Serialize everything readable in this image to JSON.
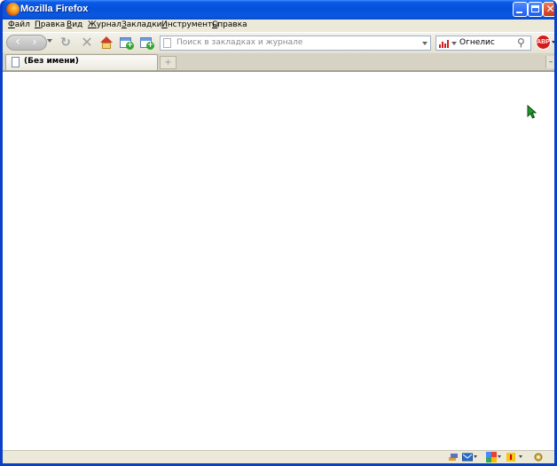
{
  "window": {
    "title": "Mozilla Firefox"
  },
  "menubar": {
    "items": [
      {
        "pre": "",
        "accel": "Ф",
        "post": "айл"
      },
      {
        "pre": "",
        "accel": "П",
        "post": "равка"
      },
      {
        "pre": "",
        "accel": "В",
        "post": "ид"
      },
      {
        "pre": "",
        "accel": "Ж",
        "post": "урнал"
      },
      {
        "pre": "",
        "accel": "З",
        "post": "акладки"
      },
      {
        "pre": "",
        "accel": "И",
        "post": "нструменты"
      },
      {
        "pre": "",
        "accel": "С",
        "post": "правка"
      }
    ]
  },
  "navbar": {
    "url_placeholder": "Поиск в закладках и журнале",
    "search_value": "Огнелис",
    "adblock_label": "ABP"
  },
  "tabs": [
    {
      "title": "(Без имени)"
    }
  ],
  "icons": {
    "back": "back-arrow-icon",
    "forward": "forward-arrow-icon",
    "reload": "reload-icon",
    "stop": "stop-icon",
    "home": "home-icon",
    "bookmark_add": "bookmark-add-icon",
    "new_tab": "new-tab-icon",
    "search_engine": "bar-chart-icon",
    "search_go": "magnifier-icon",
    "adblock": "adblock-icon",
    "cursor": "mouse-cursor-icon"
  },
  "colors": {
    "titlebar": "#0a5ae6",
    "chrome": "#ece9d8",
    "adblock": "#d61b1b"
  }
}
